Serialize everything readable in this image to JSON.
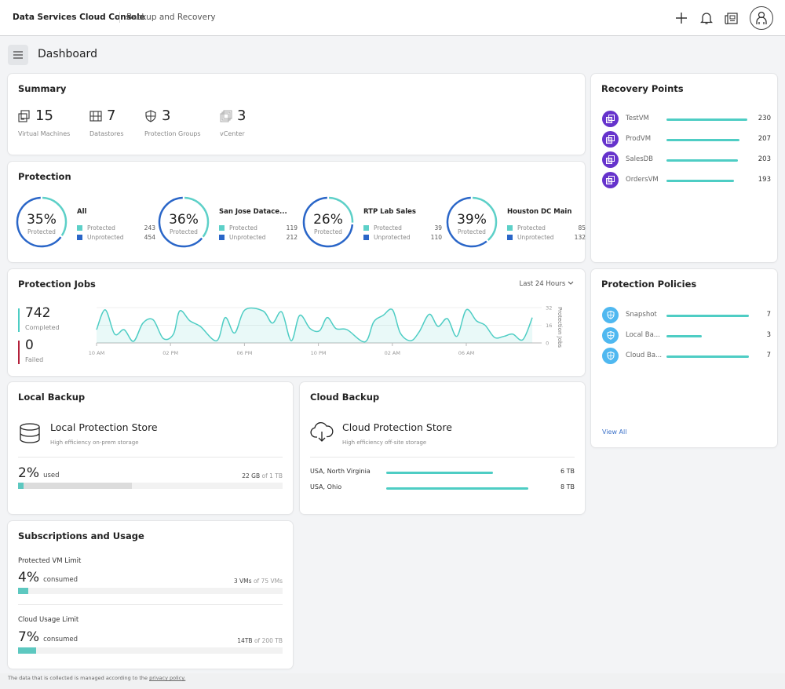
{
  "header": {
    "brand": "Data Services Cloud Console",
    "app_name": "Backup and Recovery",
    "icons": [
      "plus-icon",
      "bell-icon",
      "news-icon",
      "user-avatar-icon"
    ]
  },
  "page": {
    "title": "Dashboard",
    "menu_icon": "hamburger-icon"
  },
  "summary": {
    "title": "Summary",
    "items": [
      {
        "icon": "virtual-machine-icon",
        "value": "15",
        "label": "Virtual Machines"
      },
      {
        "icon": "datastore-icon",
        "value": "7",
        "label": "Datastores"
      },
      {
        "icon": "shield-icon",
        "value": "3",
        "label": "Protection Groups"
      },
      {
        "icon": "vcenter-icon",
        "value": "3",
        "label": "vCenter"
      }
    ]
  },
  "protection": {
    "title": "Protection",
    "colors": {
      "protected": "#5dd0c8",
      "unprotected": "#2a66c8"
    },
    "groups": [
      {
        "name": "All",
        "percent": "35%",
        "percent_value": 35,
        "sub": "Protected",
        "protected_label": "Protected",
        "protected": "243",
        "unprotected_label": "Unprotected",
        "unprotected": "454"
      },
      {
        "name": "San Jose Datace...",
        "percent": "36%",
        "percent_value": 36,
        "sub": "Protected",
        "protected_label": "Protected",
        "protected": "119",
        "unprotected_label": "Unprotected",
        "unprotected": "212"
      },
      {
        "name": "RTP Lab Sales",
        "percent": "26%",
        "percent_value": 26,
        "sub": "Protected",
        "protected_label": "Protected",
        "protected": "39",
        "unprotected_label": "Unprotected",
        "unprotected": "110"
      },
      {
        "name": "Houston DC Main",
        "percent": "39%",
        "percent_value": 39,
        "sub": "Protected",
        "protected_label": "Protected",
        "protected": "85",
        "unprotected_label": "Unprotected",
        "unprotected": "132"
      }
    ]
  },
  "recovery_points": {
    "title": "Recovery Points",
    "max": 230,
    "items": [
      {
        "name": "TestVM",
        "value": 230,
        "value_label": "230"
      },
      {
        "name": "ProdVM",
        "value": 207,
        "value_label": "207"
      },
      {
        "name": "SalesDB",
        "value": 203,
        "value_label": "203"
      },
      {
        "name": "OrdersVM",
        "value": 193,
        "value_label": "193"
      }
    ]
  },
  "protection_jobs": {
    "title": "Protection Jobs",
    "range": "Last 24 Hours",
    "completed": {
      "value": "742",
      "label": "Completed",
      "color": "#4ecdc4"
    },
    "failed": {
      "value": "0",
      "label": "Failed",
      "color": "#b3213b"
    }
  },
  "chart_data": {
    "type": "area",
    "title": "Protection Jobs",
    "xlabel": "",
    "ylabel": "Protection Jobs",
    "ylim": [
      0,
      32
    ],
    "yticks": [
      "0",
      "16",
      "32"
    ],
    "xticks": [
      {
        "label": "10 AM",
        "hour": 0
      },
      {
        "label": "02 PM",
        "hour": 4
      },
      {
        "label": "06 PM",
        "hour": 8
      },
      {
        "label": "10 PM",
        "hour": 12
      },
      {
        "label": "02 AM",
        "hour": 16
      },
      {
        "label": "06 AM",
        "hour": 20
      }
    ],
    "grid": true,
    "series": [
      {
        "name": "Protection Jobs",
        "color": "#4ecdc4",
        "hours": [
          0,
          0.47,
          0.98,
          1.49,
          2.0,
          2.51,
          3.06,
          3.61,
          4.16,
          4.5,
          5.05,
          5.61,
          6.5,
          6.96,
          7.47,
          8.03,
          9.0,
          9.51,
          10.02,
          10.53,
          10.99,
          11.55,
          12.06,
          12.48,
          12.95,
          13.55,
          14.52,
          14.99,
          15.5,
          16.01,
          16.43,
          16.99,
          17.45,
          18.0,
          18.47,
          18.98,
          19.49,
          20.0,
          20.55,
          21.02,
          21.53,
          22.04,
          22.51,
          23.06,
          23.57
        ],
        "values": [
          12,
          30,
          8,
          12,
          1.5,
          18,
          21,
          4,
          8,
          29,
          20,
          15,
          2,
          23,
          9,
          30,
          29,
          18,
          28,
          2,
          25,
          13,
          11,
          23,
          13,
          12,
          1,
          19,
          25,
          30,
          9,
          2,
          10,
          26,
          15,
          22,
          6,
          30,
          20,
          16,
          5,
          6,
          8,
          3,
          23
        ]
      }
    ]
  },
  "protection_policies": {
    "title": "Protection Policies",
    "max": 7,
    "items": [
      {
        "name": "Snapshot",
        "value": 7,
        "value_label": "7"
      },
      {
        "name": "Local Ba...",
        "value": 3,
        "value_label": "3"
      },
      {
        "name": "Cloud Ba...",
        "value": 7,
        "value_label": "7"
      }
    ],
    "view_all": "View All"
  },
  "local_backup": {
    "title": "Local Backup",
    "store_title": "Local Protection Store",
    "store_sub": "High efficiency on-prem storage",
    "percent": "2%",
    "percent_value": 2,
    "unit": "used",
    "reserved_fraction": 0.43,
    "used": "22 GB",
    "of": "of 1 TB"
  },
  "cloud_backup": {
    "title": "Cloud Backup",
    "store_title": "Cloud Protection Store",
    "store_sub": "High efficiency off-site storage",
    "max": 8,
    "regions": [
      {
        "name": "USA, North Virginia",
        "value": 6,
        "value_label": "6 TB"
      },
      {
        "name": "USA, Ohio",
        "value": 8,
        "value_label": "8 TB"
      }
    ]
  },
  "subscriptions": {
    "title": "Subscriptions and Usage",
    "limits": [
      {
        "label": "Protected VM Limit",
        "percent": "4%",
        "percent_value": 4,
        "unit": "consumed",
        "used": "3 VMs",
        "of": "of 75 VMs"
      },
      {
        "label": "Cloud Usage Limit",
        "percent": "7%",
        "percent_value": 7,
        "unit": "consumed",
        "used": "14TB",
        "of": "of 200 TB"
      }
    ]
  },
  "footer": {
    "text": "The data that is collected is managed according to the ",
    "link": "privacy policy."
  }
}
